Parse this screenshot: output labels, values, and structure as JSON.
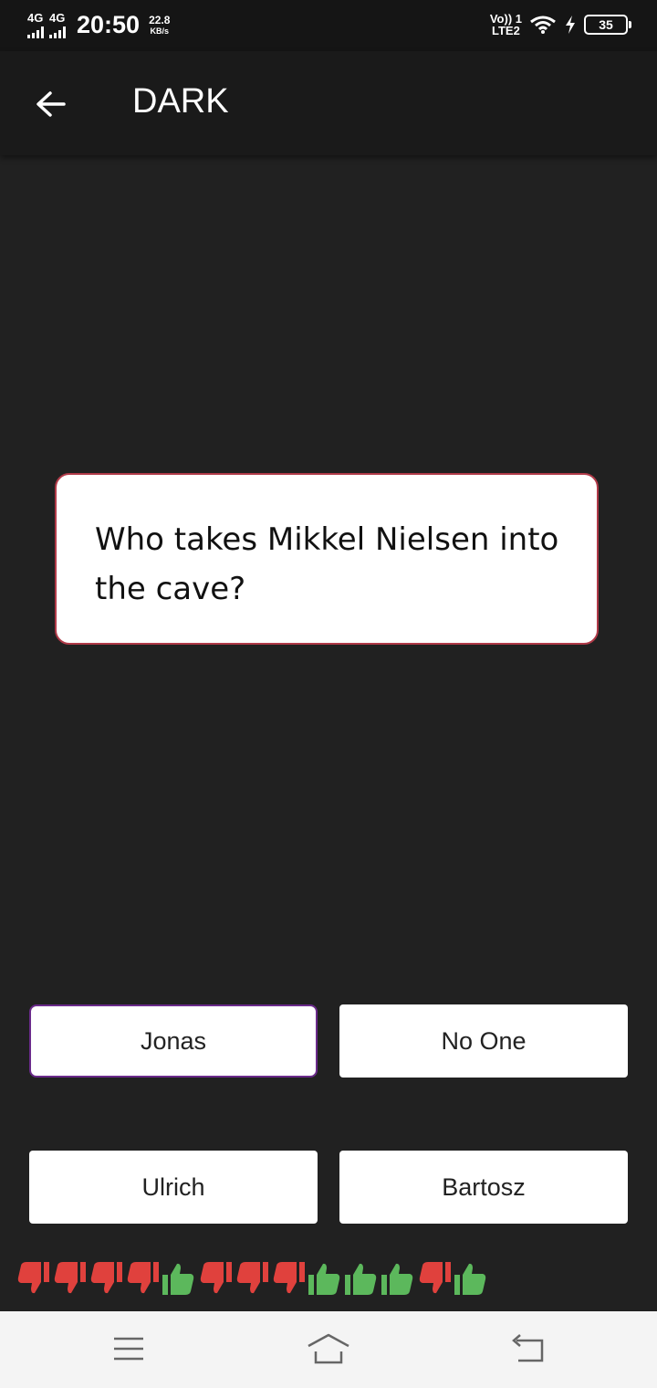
{
  "status_bar": {
    "sim1": "4G",
    "sim2": "4G",
    "time": "20:50",
    "speed_value": "22.8",
    "speed_unit": "KB/s",
    "volte_top": "Vo)) 1",
    "volte_bottom": "LTE2",
    "battery": "35"
  },
  "app_bar": {
    "title": "DARK",
    "back_icon": "arrow-back-icon"
  },
  "question": {
    "text": "Who takes Mikkel Nielsen into the cave?"
  },
  "answers": [
    {
      "label": "Jonas",
      "selected": true
    },
    {
      "label": "No One",
      "selected": false
    },
    {
      "label": "Ulrich",
      "selected": false
    },
    {
      "label": "Bartosz",
      "selected": false
    }
  ],
  "score_history": {
    "results": [
      "wrong",
      "wrong",
      "wrong",
      "wrong",
      "right",
      "wrong",
      "wrong",
      "wrong",
      "right",
      "right",
      "right",
      "wrong",
      "right"
    ],
    "colors": {
      "right": "#5cb85c",
      "wrong": "#e0413d"
    }
  },
  "nav_bar": {
    "icons": [
      "menu-icon",
      "home-icon",
      "back-icon"
    ]
  },
  "colors": {
    "background": "#212121",
    "card_border": "#b03a48",
    "selected_border": "#6a2a8a"
  }
}
